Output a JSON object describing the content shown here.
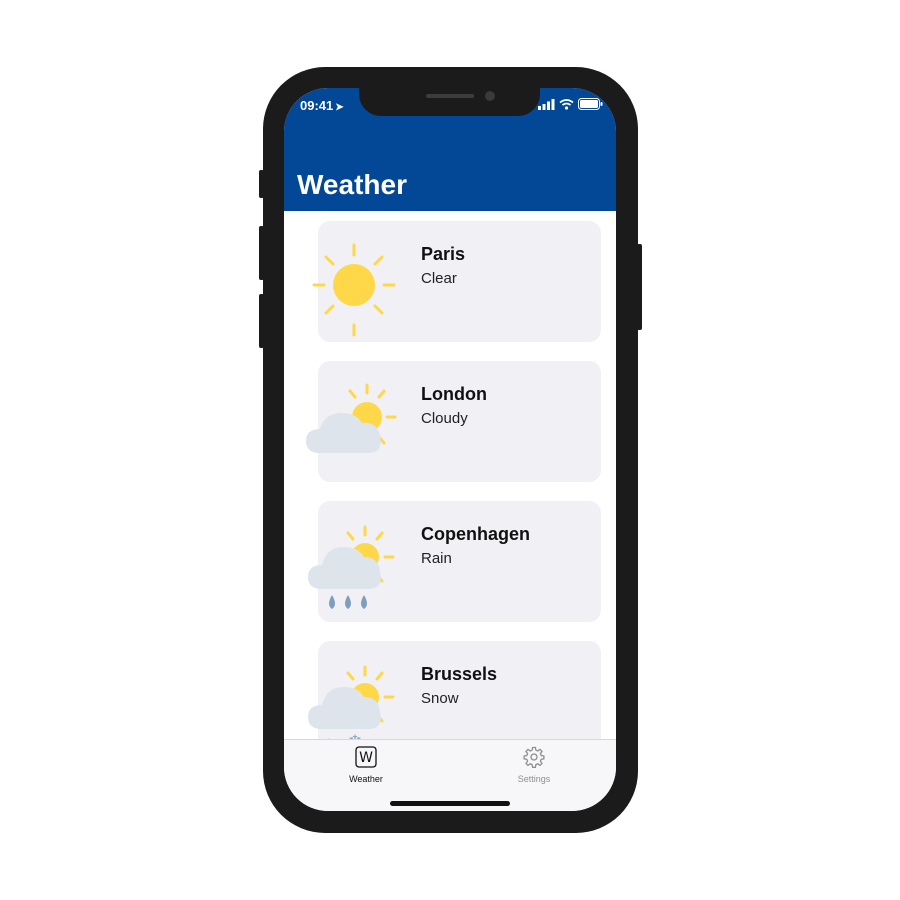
{
  "status_bar": {
    "time": "09:41"
  },
  "header": {
    "title": "Weather"
  },
  "cities": [
    {
      "name": "Paris",
      "condition": "Clear",
      "icon": "sun-icon"
    },
    {
      "name": "London",
      "condition": "Cloudy",
      "icon": "cloud-sun-icon"
    },
    {
      "name": "Copenhagen",
      "condition": "Rain",
      "icon": "rain-icon"
    },
    {
      "name": "Brussels",
      "condition": "Snow",
      "icon": "snow-icon"
    }
  ],
  "tabs": [
    {
      "label": "Weather",
      "icon_glyph": "W",
      "icon": "weather-tab-icon",
      "active": true
    },
    {
      "label": "Settings",
      "icon": "gear-icon",
      "active": false
    }
  ],
  "colors": {
    "header": "#034897",
    "card": "#f1f1f5",
    "sun": "#ffd84a",
    "cloud": "#dde4ec",
    "rain": "#7f9dbf"
  }
}
